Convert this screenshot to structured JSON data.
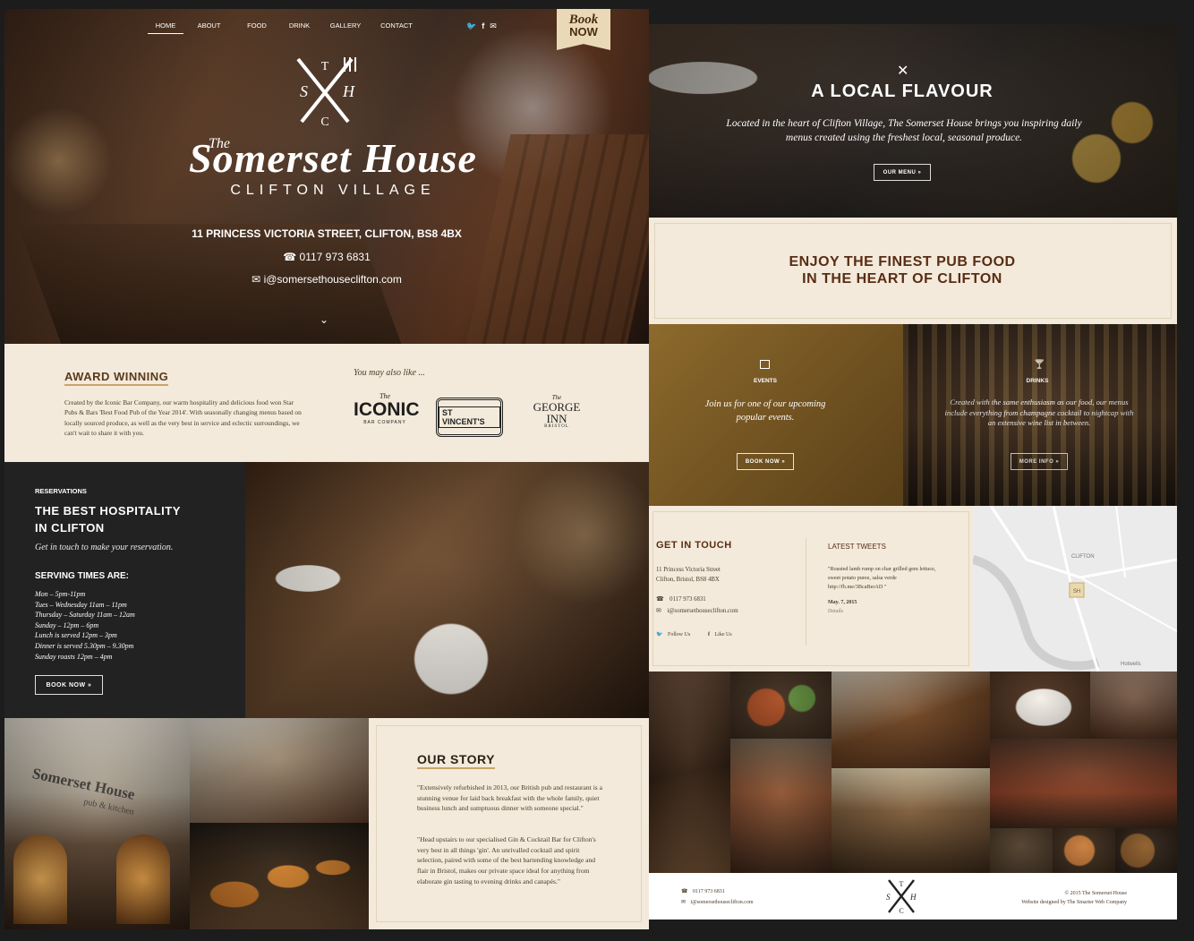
{
  "nav": {
    "items": [
      "HOME",
      "ABOUT",
      "FOOD",
      "DRINK",
      "GALLERY",
      "CONTACT"
    ],
    "book_top": "Book",
    "book_bottom": "NOW"
  },
  "hero": {
    "monogram": "T S H C",
    "title_the": "The",
    "title": "Somerset House",
    "subtitle": "CLIFTON VILLAGE",
    "address": "11 PRINCESS VICTORIA STREET, CLIFTON, BS8 4BX",
    "phone": "0117 973 6831",
    "email": "i@somersethouseclifton.com"
  },
  "award": {
    "heading": "AWARD WINNING",
    "text": "Created by the Iconic Bar Company, our warm hospitality and delicious food won Star Pubs & Bars 'Best Food Pub of the Year 2014'. With seasonally changing menus based on locally sourced produce, as well as the very best in service and eclectic surroundings, we can't wait to share it with you.",
    "also_like": "You may also like ...",
    "logos": {
      "iconic_the": "The",
      "iconic": "ICONIC",
      "iconic_sub": "BAR COMPANY",
      "stvincents": "ST VINCENT'S",
      "george_the": "The",
      "george": "GEORGE",
      "inn": "INN",
      "bristol": "BRISTOL"
    }
  },
  "reservations": {
    "label": "RESERVATIONS",
    "heading_1": "THE BEST HOSPITALITY",
    "heading_2": "IN CLIFTON",
    "intro": "Get in touch to make your reservation.",
    "serving": "SERVING TIMES ARE:",
    "times": [
      "Mon – 5pm-11pm",
      "Tues – Wednesday 11am – 11pm",
      "Thursday – Saturday 11am – 12am",
      "Sunday – 12pm – 6pm",
      "Lunch is served 12pm – 3pm",
      "Dinner is served 5.30pm – 9.30pm",
      "Sunday roasts 12pm – 4pm"
    ],
    "button": "BOOK NOW »"
  },
  "story": {
    "heading": "OUR STORY",
    "p1": "\"Extensively refurbished in 2013, our British pub and restaurant is a stunning venue for laid back breakfast with the whole family, quiet business lunch and sumptuous dinner with someone special.\"",
    "p2": "\"Head upstairs to our specialised Gin & Cocktail Bar for Clifton's very best in all things 'gin'. An unrivalled cocktail and spirit selection, paired with some of the best bartending knowledge and flair in Bristol, makes our private space ideal for anything from elaborate gin tasting to evening drinks and canapés.\"",
    "sign_1": "Somerset House",
    "sign_2": "pub & kitchen"
  },
  "local": {
    "heading": "A LOCAL FLAVOUR",
    "text": "Located in the heart of Clifton Village, The Somerset House brings you inspiring daily menus created using the freshest local, seasonal produce.",
    "button": "OUR MENU »"
  },
  "finest": {
    "line1": "ENJOY THE FINEST PUB FOOD",
    "line2": "IN THE HEART OF CLIFTON"
  },
  "events": {
    "label": "EVENTS",
    "text": "Join us for one of our upcoming popular events.",
    "button": "BOOK NOW »"
  },
  "drinks": {
    "label": "DRINKS",
    "text": "Created with the same enthusiasm as our food, our menus include everything from champagne cocktail to nightcap with an extensive wine list in between.",
    "button": "MORE INFO »"
  },
  "contact": {
    "heading": "GET IN TOUCH",
    "addr1": "11 Princess Victoria Street",
    "addr2": "Clifton, Bristol, BS8 4BX",
    "phone": "0117 973 6831",
    "email": "i@somersethouseclifton.com",
    "follow": "Follow Us",
    "like": "Like Us"
  },
  "tweets": {
    "heading": "LATEST TWEETS",
    "text": "\"Roasted lamb rump on char grilled gem lettuce, sweet potato puree, salsa verde http://fb.me/3BcaBerAD \"",
    "date": "May. 7, 2015",
    "details": "Details"
  },
  "map": {
    "marker": "SH",
    "streets": [
      "CLIFTON",
      "Hotwells"
    ]
  },
  "footer": {
    "phone": "0117 973 6831",
    "email": "i@somersethouseclifton.com",
    "monogram": "T S H C",
    "copyright": "© 2015 The Somerset House",
    "credit": "Website designed by The Smarter Web Company"
  },
  "colors": {
    "cream": "#f3eadb",
    "brown": "#5a3a1c",
    "gold": "#8a6a2c",
    "dark": "#1c1c1c"
  }
}
